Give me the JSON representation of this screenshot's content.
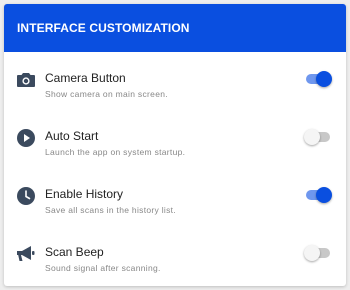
{
  "header": {
    "title": "INTERFACE CUSTOMIZATION"
  },
  "colors": {
    "accent": "#0a4fe0",
    "icon": "#3b4a5e"
  },
  "settings": [
    {
      "icon": "camera-icon",
      "title": "Camera Button",
      "subtitle": "Show camera on main screen.",
      "enabled": true
    },
    {
      "icon": "play-icon",
      "title": "Auto Start",
      "subtitle": "Launch the app on system startup.",
      "enabled": false
    },
    {
      "icon": "clock-icon",
      "title": "Enable History",
      "subtitle": "Save all scans in the history list.",
      "enabled": true
    },
    {
      "icon": "megaphone-icon",
      "title": "Scan Beep",
      "subtitle": "Sound signal after scanning.",
      "enabled": false
    }
  ]
}
